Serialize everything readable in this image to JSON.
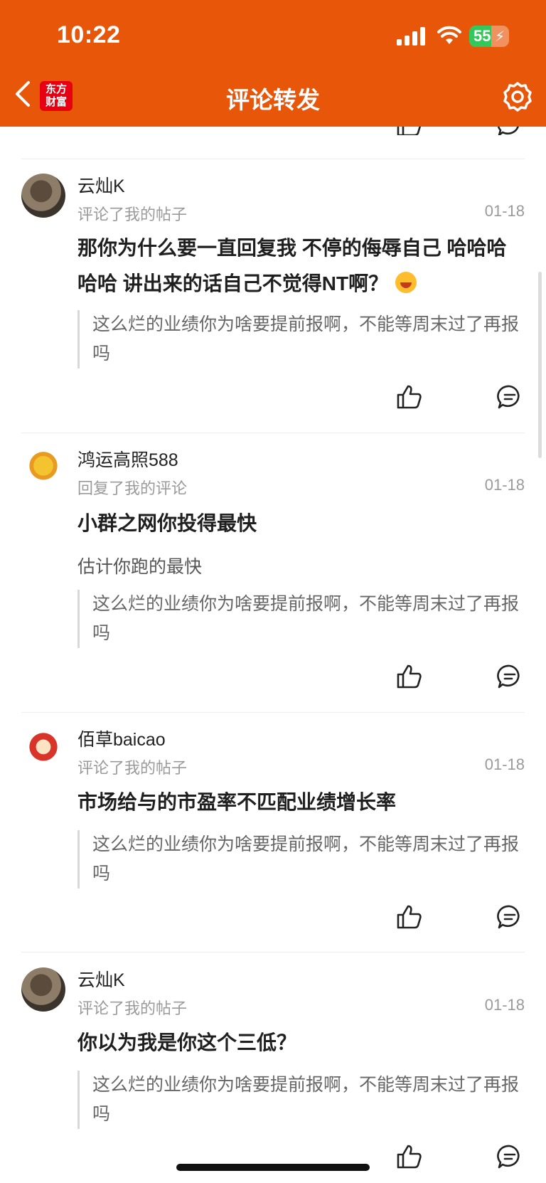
{
  "status": {
    "time": "10:22",
    "battery_level": "55",
    "battery_fraction": 0.55
  },
  "header": {
    "title": "评论转发",
    "logo_line1": "东方",
    "logo_line2": "财富"
  },
  "comments": [
    {
      "username": "云灿K",
      "action": "评论了我的帖子",
      "date": "01-18",
      "content": "那你为什么要一直回复我 不停的侮辱自己 哈哈哈哈哈 讲出来的话自己不觉得NT啊？",
      "quote": "这么烂的业绩你为啥要提前报啊，不能等周末过了再报吗"
    },
    {
      "username": "鸿运高照588",
      "action": "回复了我的评论",
      "date": "01-18",
      "content": "小群之网你投得最快",
      "reply": "估计你跑的最快",
      "quote": "这么烂的业绩你为啥要提前报啊，不能等周末过了再报吗"
    },
    {
      "username": "佰草baicao",
      "action": "评论了我的帖子",
      "date": "01-18",
      "content": "市场给与的市盈率不匹配业绩增长率",
      "quote": "这么烂的业绩你为啥要提前报啊，不能等周末过了再报吗"
    },
    {
      "username": "云灿K",
      "action": "评论了我的帖子",
      "date": "01-18",
      "content": "你以为我是你这个三低？",
      "quote": "这么烂的业绩你为啥要提前报啊，不能等周末过了再报吗"
    }
  ],
  "colors": {
    "header_bg": "#e8560a",
    "battery_green": "#34c759"
  },
  "icons": [
    "back-chevron-icon",
    "settings-gear-icon",
    "thumbs-up-icon",
    "comment-bubble-icon",
    "laughing-emoji-icon",
    "signal-icon",
    "wifi-icon",
    "battery-icon"
  ]
}
